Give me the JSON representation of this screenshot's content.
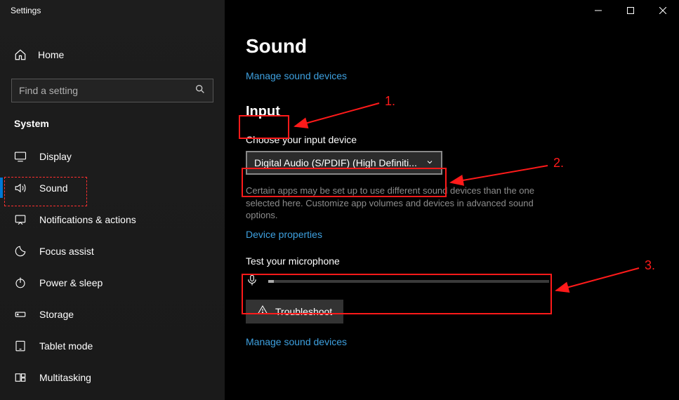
{
  "titlebar": {
    "title": "Settings"
  },
  "sidebar": {
    "home": "Home",
    "search_placeholder": "Find a setting",
    "section": "System",
    "items": [
      {
        "label": "Display"
      },
      {
        "label": "Sound"
      },
      {
        "label": "Notifications & actions"
      },
      {
        "label": "Focus assist"
      },
      {
        "label": "Power & sleep"
      },
      {
        "label": "Storage"
      },
      {
        "label": "Tablet mode"
      },
      {
        "label": "Multitasking"
      }
    ]
  },
  "main": {
    "title": "Sound",
    "manage_link_top": "Manage sound devices",
    "input_heading": "Input",
    "choose_label": "Choose your input device",
    "combo_value": "Digital Audio (S/PDIF) (High Definiti...",
    "helper": "Certain apps may be set up to use different sound devices than the one selected here. Customize app volumes and devices in advanced sound options.",
    "device_props": "Device properties",
    "test_label": "Test your microphone",
    "troubleshoot": "Troubleshoot",
    "manage_link_bottom": "Manage sound devices"
  },
  "annotations": {
    "l1": "1.",
    "l2": "2.",
    "l3": "3."
  }
}
